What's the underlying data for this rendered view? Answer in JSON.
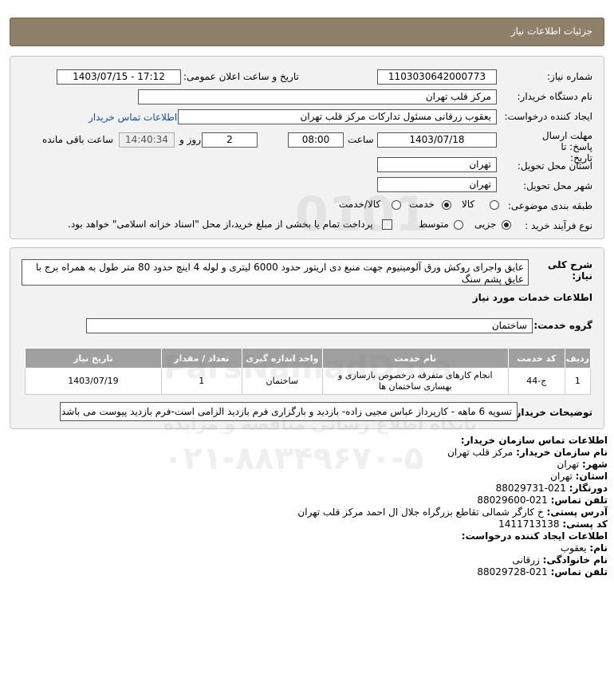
{
  "header": {
    "title": "جزئیات اطلاعات نیاز"
  },
  "fields": {
    "need_number_label": "شماره نیاز:",
    "need_number": "1103030642000773",
    "announce_label": "تاریخ و ساعت اعلان عمومی:",
    "announce_value": "1403/07/15 - 17:12",
    "buyer_org_label": "نام دستگاه خریدار:",
    "buyer_org": "مرکز قلب تهران",
    "creator_label": "ایجاد کننده درخواست:",
    "creator": "یعقوب زرقانی مسئول تدارکات مرکز قلب تهران",
    "contact_link": "اطلاعات تماس خریدار",
    "deadline_label": "مهلت ارسال پاسخ: تا تاریخ:",
    "deadline_date": "1403/07/18",
    "time_label": "ساعت",
    "deadline_time": "08:00",
    "days": "2",
    "days_label": "روز و",
    "remaining_time": "14:40:34",
    "remaining_label": "ساعت باقی مانده",
    "province_label": "استان محل تحویل:",
    "province": "تهران",
    "city_label": "شهر محل تحویل:",
    "city": "تهران",
    "category_label": "طبقه بندی موضوعی:",
    "category_options": [
      "کالا",
      "خدمت",
      "کالا/خدمت"
    ],
    "purchase_type_label": "نوع فرآیند خرید :",
    "purchase_options": [
      "جزیی",
      "متوسط"
    ],
    "payment_note": "پرداخت تمام یا بخشی از مبلغ خرید،از محل \"اسناد خزانه اسلامی\" خواهد بود."
  },
  "description": {
    "label": "شرح کلی نیاز:",
    "text": "عایق واجرای روکش ورق آلومینیوم جهت منبع دی اریتور حدود 6000 لیتری و لوله 4 اینچ حدود 80 متر طول به همراه برج با عایق پشم سنگ"
  },
  "services": {
    "section_title": "اطلاعات خدمات مورد نیاز",
    "group_label": "گروه خدمت:",
    "group_value": "ساختمان",
    "columns": [
      "ردیف",
      "کد خدمت",
      "نام خدمت",
      "واحد اندازه گیری",
      "تعداد / مقدار",
      "تاریخ نیاز"
    ],
    "rows": [
      {
        "row": "1",
        "code": "ج-44",
        "name": "انجام کارهای متفرقه درخصوص بازسازی و بهسازی ساختمان ها",
        "unit": "ساختمان",
        "qty": "1",
        "date": "1403/07/19"
      }
    ],
    "buyer_notes_label": "توضیحات خریدار:",
    "buyer_notes": "تسویه 6 ماهه - کارپرداز عباس مجیی زاده- بازدید و بارگزاری فرم بازدید الزامی است-فرم بازدید پیوست می باشد"
  },
  "contact": {
    "title": "اطلاعات تماس سازمان خریدار:",
    "org_label": "نام سازمان خریدار:",
    "org": "مرکز قلب تهران",
    "city_label": "شهر:",
    "city": "تهران",
    "province_label": "استان:",
    "province": "تهران",
    "fax_label": "دورنگار:",
    "fax": "021-88029731",
    "phone_label": "تلفن تماس:",
    "phone": "021-88029600",
    "address_label": "آدرس پستی:",
    "address": "خ کارگر شمالی تقاطع بزرگراه جلال ال احمد مرکز قلب تهران",
    "postal_label": "کد پستی:",
    "postal": "1411713138",
    "creator_title": "اطلاعات ایجاد کننده درخواست:",
    "name_label": "نام:",
    "name": "یعقوب",
    "family_label": "نام خانوادگی:",
    "family": "زرقانی",
    "creator_phone_label": "تلفن تماس:",
    "creator_phone": "021-88029728"
  },
  "watermark": {
    "brand": "ParsNamadData",
    "line1": "پایگاه اطلاع رسانی مناقصه و مزایده",
    "line2": "۰۲۱-۸۸۳۴۹۶۷۰-۵",
    "digits": "0101"
  }
}
